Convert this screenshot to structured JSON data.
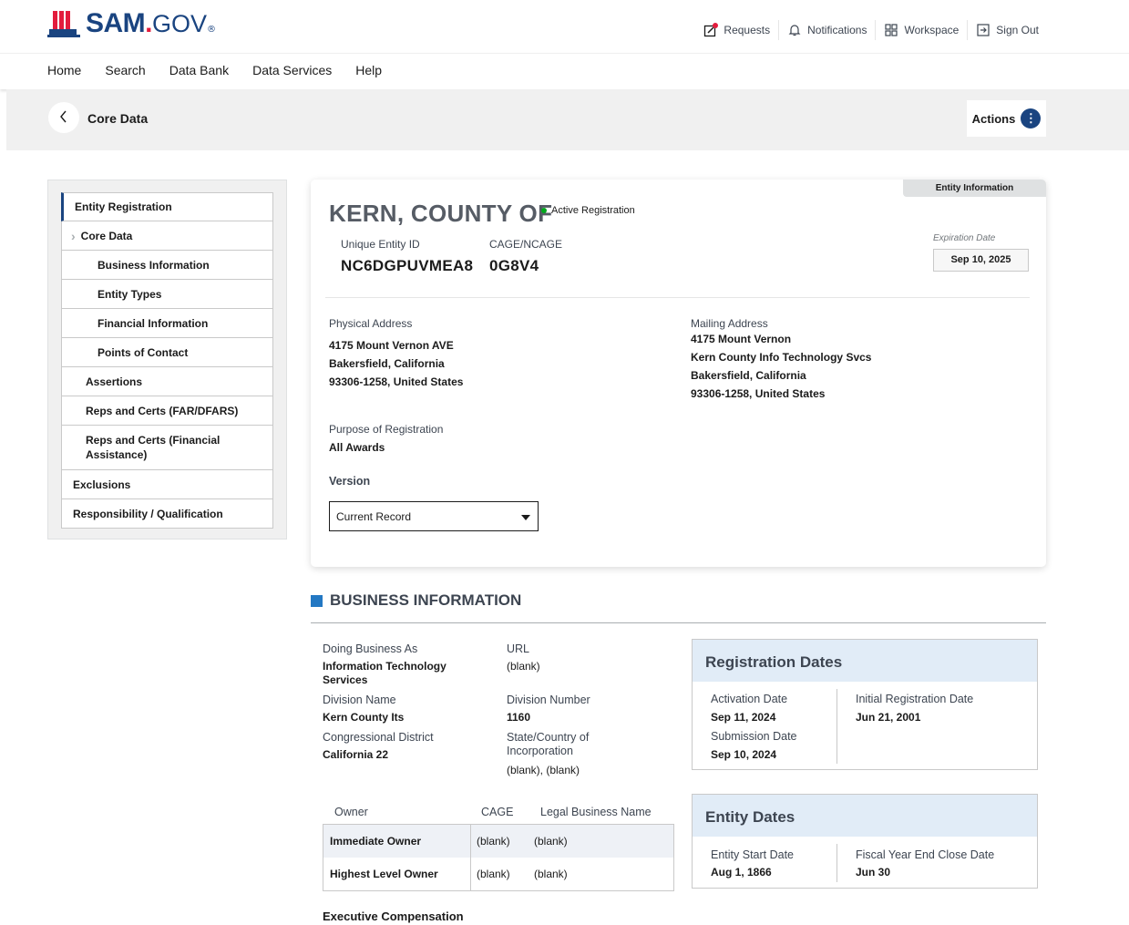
{
  "header": {
    "logo_main": "SAM",
    "logo_dot": ".",
    "logo_gov": "GOV",
    "logo_reg": "®",
    "util": {
      "requests": "Requests",
      "notifications": "Notifications",
      "workspace": "Workspace",
      "signout": "Sign Out"
    }
  },
  "nav": {
    "home": "Home",
    "search": "Search",
    "data_bank": "Data Bank",
    "data_services": "Data Services",
    "help": "Help"
  },
  "subbar": {
    "back_icon": "chevron-left-icon",
    "title": "Core Data",
    "actions": "Actions"
  },
  "sidebar": {
    "items": [
      {
        "label": "Entity Registration",
        "level": 0
      },
      {
        "label": "Core Data",
        "level": 1
      },
      {
        "label": "Business Information",
        "level": 2
      },
      {
        "label": "Entity Types",
        "level": 2
      },
      {
        "label": "Financial Information",
        "level": 2
      },
      {
        "label": "Points of Contact",
        "level": 2
      },
      {
        "label": "Assertions",
        "level": 1
      },
      {
        "label": "Reps and Certs (FAR/DFARS)",
        "level": 1
      },
      {
        "label": "Reps and Certs (Financial Assistance)",
        "level": 1
      },
      {
        "label": "Exclusions",
        "level": 0
      },
      {
        "label": "Responsibility / Qualification",
        "level": 0
      }
    ]
  },
  "entity": {
    "tab_label": "Entity Information",
    "name": "KERN, COUNTY OF",
    "status": "Active Registration",
    "uei_label": "Unique Entity ID",
    "uei": "NC6DGPUVMEA8",
    "cage_label": "CAGE/NCAGE",
    "cage": "0G8V4",
    "exp_label": "Expiration Date",
    "exp_date": "Sep 10, 2025",
    "physical_label": "Physical Address",
    "physical": [
      "4175 Mount Vernon AVE",
      "Bakersfield, California",
      "93306-1258, United States"
    ],
    "mailing_label": "Mailing Address",
    "mailing": [
      "4175 Mount Vernon",
      "Kern County Info Technology Svcs",
      "Bakersfield, California",
      "93306-1258, United States"
    ],
    "purpose_label": "Purpose of Registration",
    "purpose": "All Awards",
    "version_label": "Version",
    "version_value": "Current Record"
  },
  "business": {
    "section_title": "BUSINESS INFORMATION",
    "dba_label": "Doing Business As",
    "dba_value": "Information Technology Services",
    "url_label": "URL",
    "url_value": "(blank)",
    "division_name_label": "Division Name",
    "division_name_value": "Kern County Its",
    "division_number_label": "Division Number",
    "division_number_value": "1160",
    "congress_label": "Congressional District",
    "congress_value": "California 22",
    "state_label": "State/Country of Incorporation",
    "state_value": "(blank), (blank)",
    "owner_headers": [
      "Owner",
      "CAGE",
      "Legal Business Name"
    ],
    "owners": [
      {
        "owner": "Immediate Owner",
        "cage": "(blank)",
        "name": "(blank)"
      },
      {
        "owner": "Highest Level Owner",
        "cage": "(blank)",
        "name": "(blank)"
      }
    ],
    "exec_comp": "Executive Compensation"
  },
  "registration_dates": {
    "title": "Registration Dates",
    "activation_label": "Activation Date",
    "activation_value": "Sep 11, 2024",
    "submission_label": "Submission Date",
    "submission_value": "Sep 10, 2024",
    "initial_label": "Initial Registration Date",
    "initial_value": "Jun 21, 2001"
  },
  "entity_dates": {
    "title": "Entity Dates",
    "start_label": "Entity Start Date",
    "start_value": "Aug 1, 1866",
    "fiscal_label": "Fiscal Year End Close Date",
    "fiscal_value": "Jun 30"
  },
  "colors": {
    "brand": "#1a4480",
    "accent_red": "#e31c3d",
    "active_green": "#00a91c",
    "section_blue": "#2378c3",
    "date_header_bg": "#e1ecf7"
  }
}
